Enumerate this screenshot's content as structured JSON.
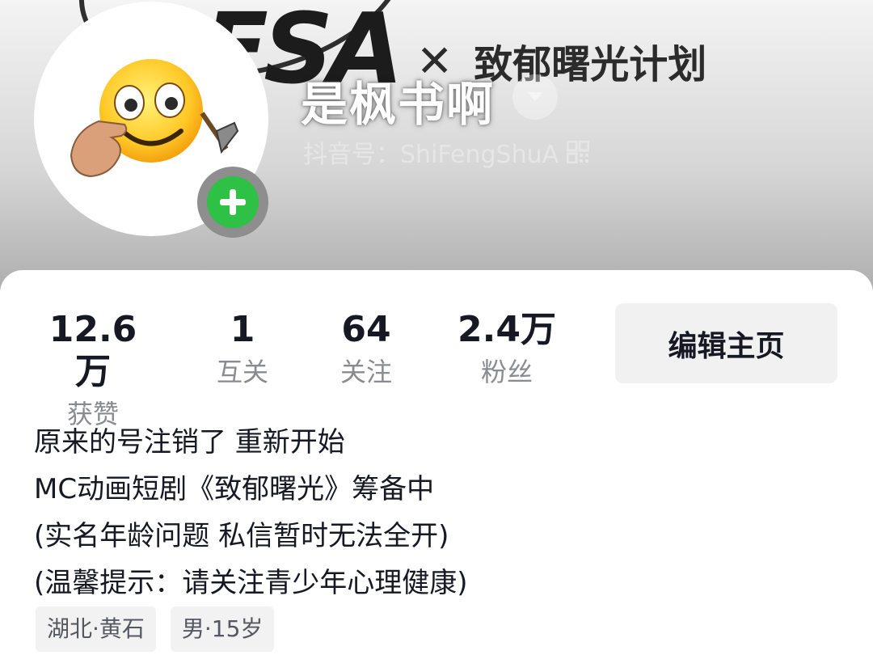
{
  "banner": {
    "logo_text": "FSA",
    "collab_close_glyph": "✕",
    "collab_title": "致郁曙光计划"
  },
  "profile": {
    "nickname": "是枫书啊",
    "douyin_id": "抖音号：ShiFengShuA",
    "avatar_icon": "smiley-pointing-with-pickaxe",
    "add_icon": "plus-icon"
  },
  "stats": [
    {
      "value": "12.6万",
      "label": "获赞"
    },
    {
      "value": "1",
      "label": "互关"
    },
    {
      "value": "64",
      "label": "关注"
    },
    {
      "value": "2.4万",
      "label": "粉丝"
    }
  ],
  "edit_button_label": "编辑主页",
  "bio": [
    "原来的号注销了 重新开始",
    "MC动画短剧《致郁曙光》筹备中",
    "(实名年龄问题 私信暂时无法全开)",
    "(温馨提示：请关注青少年心理健康)"
  ],
  "tags": [
    "湖北·黄石",
    "男·15岁"
  ],
  "colors": {
    "add_button": "#2fc046",
    "text_primary": "#161823",
    "text_secondary": "#8a8b91"
  }
}
